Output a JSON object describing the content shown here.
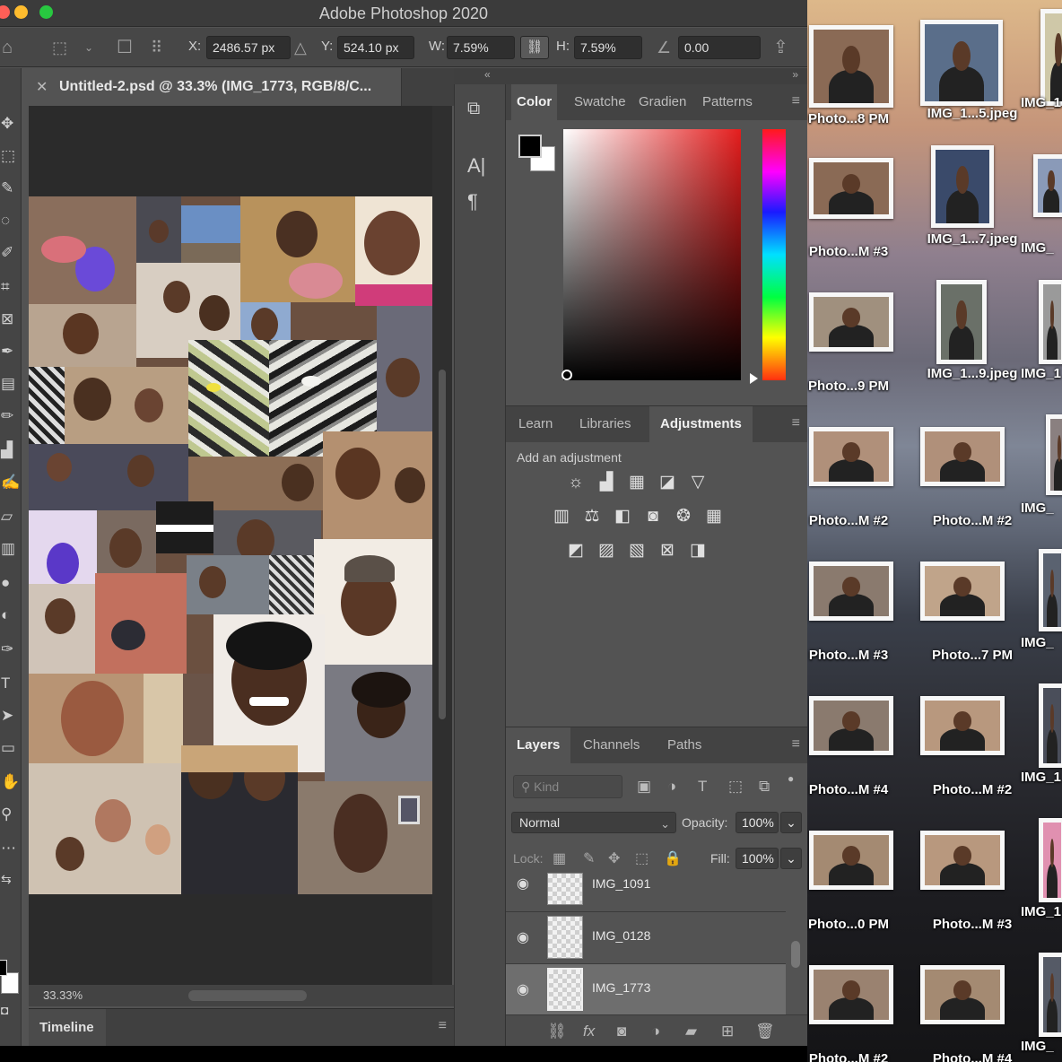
{
  "app": {
    "title": "Adobe Photoshop 2020"
  },
  "options_bar": {
    "x_label": "X:",
    "x_value": "2486.57 px",
    "y_label": "Y:",
    "y_value": "524.10 px",
    "w_label": "W:",
    "w_value": "7.59%",
    "h_label": "H:",
    "h_value": "7.59%",
    "angle_value": "0.00"
  },
  "document": {
    "tab_title": "Untitled-2.psd @ 33.3% (IMG_1773, RGB/8/C...",
    "zoom": "33.33%"
  },
  "timeline": {
    "label": "Timeline"
  },
  "color_panel": {
    "tabs": [
      "Color",
      "Swatche",
      "Gradien",
      "Patterns"
    ],
    "foreground": "#000000",
    "background": "#ffffff"
  },
  "adjustments_panel": {
    "tabs": [
      "Learn",
      "Libraries",
      "Adjustments"
    ],
    "subtitle": "Add an adjustment"
  },
  "layers_panel": {
    "tabs": [
      "Layers",
      "Channels",
      "Paths"
    ],
    "kind_placeholder": "Kind",
    "blend_mode": "Normal",
    "opacity_label": "Opacity:",
    "opacity_value": "100%",
    "lock_label": "Lock:",
    "fill_label": "Fill:",
    "fill_value": "100%",
    "layers": [
      {
        "name": "IMG_1091",
        "selected": false
      },
      {
        "name": "IMG_0128",
        "selected": false
      },
      {
        "name": "IMG_1773",
        "selected": true
      }
    ]
  },
  "desktop": {
    "col1": [
      "Photo...8 PM",
      "Photo...M #3",
      "Photo...9 PM",
      "Photo...M #2",
      "Photo...M #3",
      "Photo...M #4",
      "Photo...0 PM",
      "Photo...M #2"
    ],
    "col2": [
      "IMG_1...5.jpeg",
      "IMG_1...7.jpeg",
      "IMG_1...9.jpeg",
      "Photo...M #2",
      "Photo...7 PM",
      "Photo...M #2",
      "Photo...M #3",
      "Photo...M #4"
    ],
    "col3": [
      "IMG_1",
      "IMG_",
      "IMG_1",
      "IMG_",
      "IMG_",
      "IMG_1",
      "IMG_1",
      "IMG_"
    ]
  }
}
